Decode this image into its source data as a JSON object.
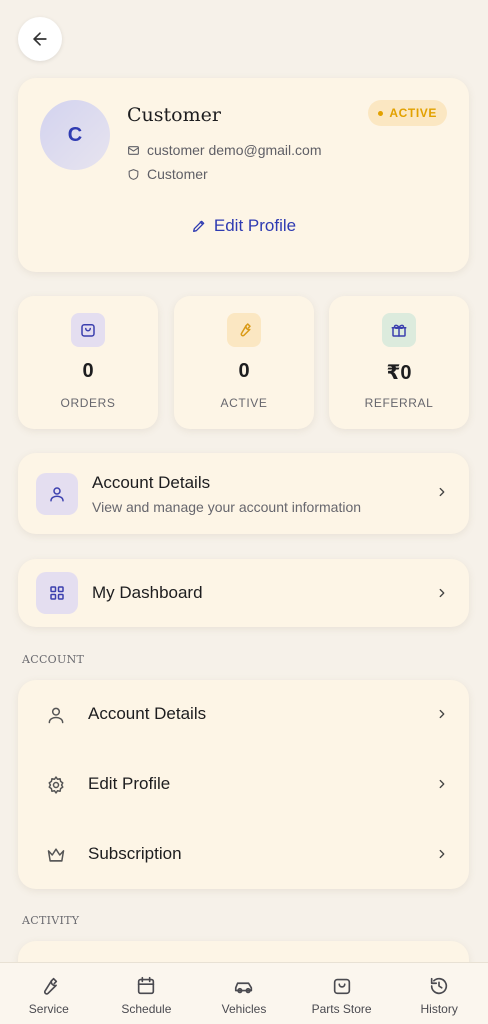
{
  "profile": {
    "avatar_initial": "C",
    "name": "Customer",
    "status": "ACTIVE",
    "email": "customer demo@gmail.com",
    "role": "Customer",
    "edit_label": "Edit Profile"
  },
  "stats": [
    {
      "value": "0",
      "label": "ORDERS",
      "icon": "shopping-bag-icon"
    },
    {
      "value": "0",
      "label": "ACTIVE",
      "icon": "wrench-icon"
    },
    {
      "value": "₹0",
      "label": "REFERRAL",
      "icon": "gift-icon"
    }
  ],
  "account_details_card": {
    "title": "Account Details",
    "subtitle": "View and manage your account information"
  },
  "dashboard_card": {
    "title": "My Dashboard"
  },
  "sections": {
    "account": "ACCOUNT",
    "activity": "ACTIVITY"
  },
  "account_list": [
    {
      "label": "Account Details",
      "icon": "user-icon"
    },
    {
      "label": "Edit Profile",
      "icon": "gear-icon"
    },
    {
      "label": "Subscription",
      "icon": "crown-icon"
    }
  ],
  "bottom_nav": [
    {
      "label": "Service",
      "icon": "wrench-icon"
    },
    {
      "label": "Schedule",
      "icon": "calendar-icon"
    },
    {
      "label": "Vehicles",
      "icon": "car-icon"
    },
    {
      "label": "Parts Store",
      "icon": "shopping-bag-icon"
    },
    {
      "label": "History",
      "icon": "history-icon"
    }
  ],
  "colors": {
    "background": "#f6f1e9",
    "card": "#fdf5e6",
    "accent": "#2f3bb2",
    "active_badge": "#e2a100"
  }
}
